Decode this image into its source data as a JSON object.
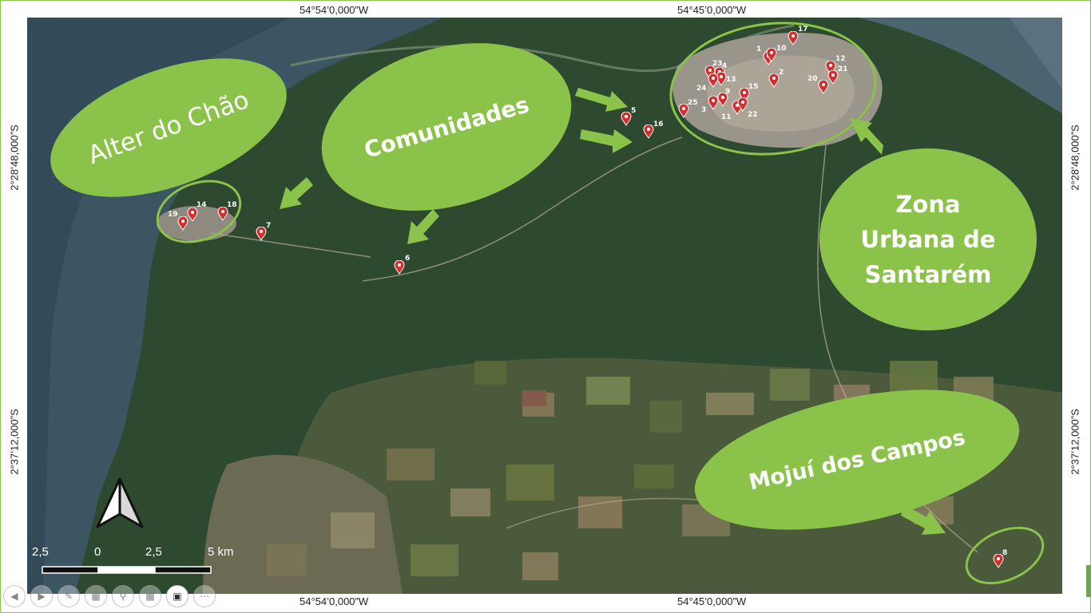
{
  "coordinates": {
    "top_left": "54°54’0,000”W",
    "top_right": "54°45’0,000”W",
    "bottom_left": "54°54’0,000”W",
    "bottom_right": "54°45’0,000”W",
    "left_upper": "2°28’48,000”S",
    "left_lower": "2°37’12,000”S",
    "right_upper": "2°28’48,000”S",
    "right_lower": "2°37’12,000”S"
  },
  "labels": {
    "alter": "Alter do Chão",
    "comunidades": "Comunidades",
    "zona_line1": "Zona",
    "zona_line2": "Urbana de",
    "zona_line3": "Santarém",
    "mojui": "Mojuí dos Campos"
  },
  "markers": [
    "1",
    "2",
    "3",
    "4",
    "5",
    "6",
    "7",
    "8",
    "9",
    "10",
    "11",
    "12",
    "13",
    "14",
    "15",
    "16",
    "17",
    "18",
    "19",
    "20",
    "21",
    "22",
    "23",
    "24",
    "25"
  ],
  "scale": {
    "ticks": [
      "2,5",
      "0",
      "2,5",
      "5 km"
    ]
  },
  "toolbar": {
    "buttons": [
      "prev",
      "next",
      "pen",
      "slides",
      "zoom",
      "subtitles",
      "camera",
      "more"
    ]
  },
  "colors": {
    "bubble": "#8bc34a",
    "marker": "#d32f2f",
    "water": "#3d5a69",
    "forest": "#2c4630"
  }
}
